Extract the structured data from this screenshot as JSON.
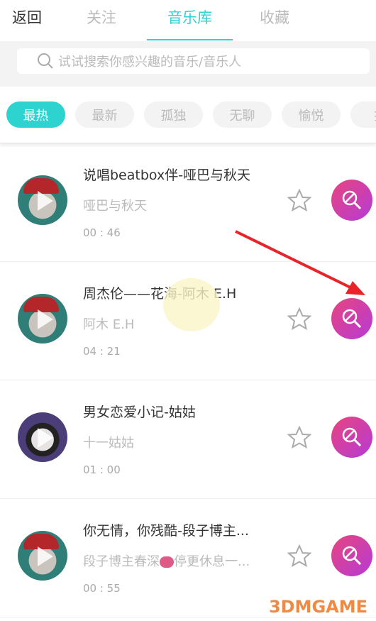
{
  "header": {
    "back": "返回",
    "tabs": [
      {
        "label": "关注"
      },
      {
        "label": "音乐库",
        "active": true
      },
      {
        "label": "收藏"
      }
    ]
  },
  "search": {
    "placeholder": "试试搜索你感兴趣的音乐/音乐人",
    "icon": "search-icon"
  },
  "chips": [
    {
      "label": "最热",
      "active": true
    },
    {
      "label": "最新"
    },
    {
      "label": "孤独"
    },
    {
      "label": "无聊"
    },
    {
      "label": "愉悦"
    },
    {
      "label": "扌"
    }
  ],
  "songs": [
    {
      "title": "说唱beatbox伴-哑巴与秋天",
      "artist": "哑巴与秋天",
      "duration": "00 : 46"
    },
    {
      "title": "周杰伦——花海-阿木  E.H",
      "artist": "阿木    E.H",
      "duration": "04 : 21"
    },
    {
      "title": "男女恋爱小记-姑姑",
      "artist": "十一姑姑",
      "duration": "01 : 00"
    },
    {
      "title": "你无情，你残酷-段子博主...",
      "artist_pre": "段子博主春深",
      "artist_post": "停更休息一...",
      "duration": "00 : 55"
    }
  ],
  "colors": {
    "accent": "#2cd3cf",
    "mic_gradient": [
      "#e8457f",
      "#b53ad6"
    ],
    "arrow": "#e8232a"
  },
  "watermark": "3DMGAME"
}
